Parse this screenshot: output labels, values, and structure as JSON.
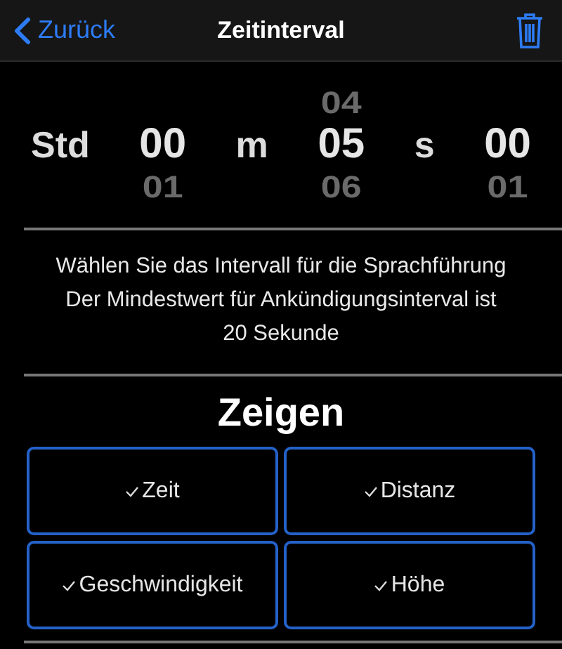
{
  "nav": {
    "back": "Zurück",
    "title": "Zeitinterval"
  },
  "picker": [
    {
      "label": "Std",
      "values": [
        {
          "text": "00",
          "selected": true
        },
        {
          "text": "01",
          "selected": false
        }
      ]
    },
    {
      "label": "m",
      "values": [
        {
          "text": "04",
          "selected": false
        },
        {
          "text": "05",
          "selected": true
        },
        {
          "text": "06",
          "selected": false
        }
      ]
    },
    {
      "label": "s",
      "values": [
        {
          "text": "00",
          "selected": true
        },
        {
          "text": "01",
          "selected": false
        }
      ]
    }
  ],
  "info": [
    "Wählen Sie das Intervall für die Sprachführung",
    "Der Mindestwert für Ankündigungsinterval ist",
    "20 Sekunde"
  ],
  "section_title": "Zeigen",
  "options": [
    {
      "label": "Zeit",
      "checked": true
    },
    {
      "label": "Distanz",
      "checked": true
    },
    {
      "label": "Geschwindigkeit",
      "checked": true
    },
    {
      "label": "Höhe",
      "checked": true
    }
  ]
}
